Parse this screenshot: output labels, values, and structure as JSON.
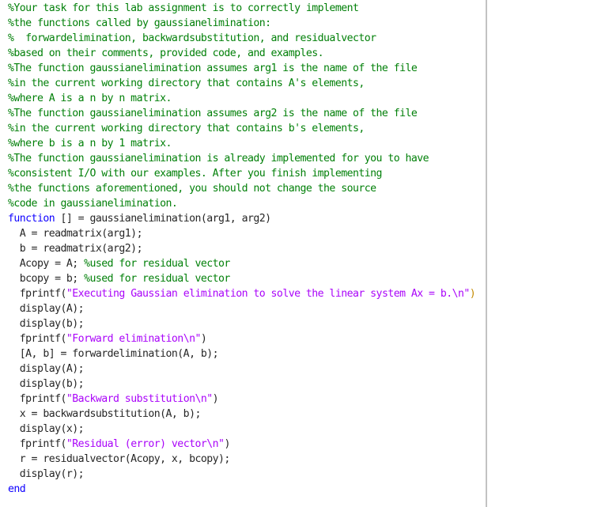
{
  "editor": {
    "language": "MATLAB",
    "colors": {
      "comment": "#028009",
      "keyword": "#0e00ff",
      "string": "#aa04f9",
      "plain": "#262626",
      "right_margin_line": "#c2c2c2"
    },
    "lines": [
      [
        {
          "t": "comment",
          "v": "%Your task for this lab assignment is to correctly implement"
        }
      ],
      [
        {
          "t": "comment",
          "v": "%the functions called by gaussianelimination:"
        }
      ],
      [
        {
          "t": "comment",
          "v": "%  forwardelimination, backwardsubstitution, and residualvector"
        }
      ],
      [
        {
          "t": "comment",
          "v": "%based on their comments, provided code, and examples."
        }
      ],
      [
        {
          "t": "comment",
          "v": "%The function gaussianelimination assumes arg1 is the name of the file"
        }
      ],
      [
        {
          "t": "comment",
          "v": "%in the current working directory that contains A's elements,"
        }
      ],
      [
        {
          "t": "comment",
          "v": "%where A is a n by n matrix."
        }
      ],
      [
        {
          "t": "comment",
          "v": "%The function gaussianelimination assumes arg2 is the name of the file"
        }
      ],
      [
        {
          "t": "comment",
          "v": "%in the current working directory that contains b's elements,"
        }
      ],
      [
        {
          "t": "comment",
          "v": "%where b is a n by 1 matrix."
        }
      ],
      [
        {
          "t": "comment",
          "v": "%The function gaussianelimination is already implemented for you to have"
        }
      ],
      [
        {
          "t": "comment",
          "v": "%consistent I/O with our examples. After you finish implementing"
        }
      ],
      [
        {
          "t": "comment",
          "v": "%the functions aforementioned, you should not change the source"
        }
      ],
      [
        {
          "t": "comment",
          "v": "%code in gaussianelimination."
        }
      ],
      [
        {
          "t": "keyword",
          "v": "function"
        },
        {
          "t": "plain",
          "v": " [] = gaussianelimination(arg1, arg2)"
        }
      ],
      [
        {
          "t": "plain",
          "v": "  A = readmatrix(arg1);"
        }
      ],
      [
        {
          "t": "plain",
          "v": "  b = readmatrix(arg2);"
        }
      ],
      [
        {
          "t": "plain",
          "v": "  Acopy = A; "
        },
        {
          "t": "comment",
          "v": "%used for residual vector"
        }
      ],
      [
        {
          "t": "plain",
          "v": "  bcopy = b; "
        },
        {
          "t": "comment",
          "v": "%used for residual vector"
        }
      ],
      [
        {
          "t": "plain",
          "v": "  fprintf("
        },
        {
          "t": "string",
          "v": "\"Executing Gaussian elimination to solve the linear system Ax = b.\\n\""
        },
        {
          "t": "paren-hl",
          "v": ")"
        }
      ],
      [
        {
          "t": "plain",
          "v": "  display(A);"
        }
      ],
      [
        {
          "t": "plain",
          "v": "  display(b);"
        }
      ],
      [
        {
          "t": "plain",
          "v": "  fprintf("
        },
        {
          "t": "string",
          "v": "\"Forward elimination\\n\""
        },
        {
          "t": "plain",
          "v": ")"
        }
      ],
      [
        {
          "t": "plain",
          "v": "  [A, b] = forwardelimination(A, b);"
        }
      ],
      [
        {
          "t": "plain",
          "v": "  display(A);"
        }
      ],
      [
        {
          "t": "plain",
          "v": "  display(b);"
        }
      ],
      [
        {
          "t": "plain",
          "v": "  fprintf("
        },
        {
          "t": "string",
          "v": "\"Backward substitution\\n\""
        },
        {
          "t": "plain",
          "v": ")"
        }
      ],
      [
        {
          "t": "plain",
          "v": "  x = backwardsubstitution(A, b);"
        }
      ],
      [
        {
          "t": "plain",
          "v": "  display(x);"
        }
      ],
      [
        {
          "t": "plain",
          "v": "  fprintf("
        },
        {
          "t": "string",
          "v": "\"Residual (error) vector\\n\""
        },
        {
          "t": "plain",
          "v": ")"
        }
      ],
      [
        {
          "t": "plain",
          "v": "  r = residualvector(Acopy, x, bcopy);"
        }
      ],
      [
        {
          "t": "plain",
          "v": "  display(r);"
        }
      ],
      [
        {
          "t": "keyword",
          "v": "end"
        }
      ]
    ]
  }
}
